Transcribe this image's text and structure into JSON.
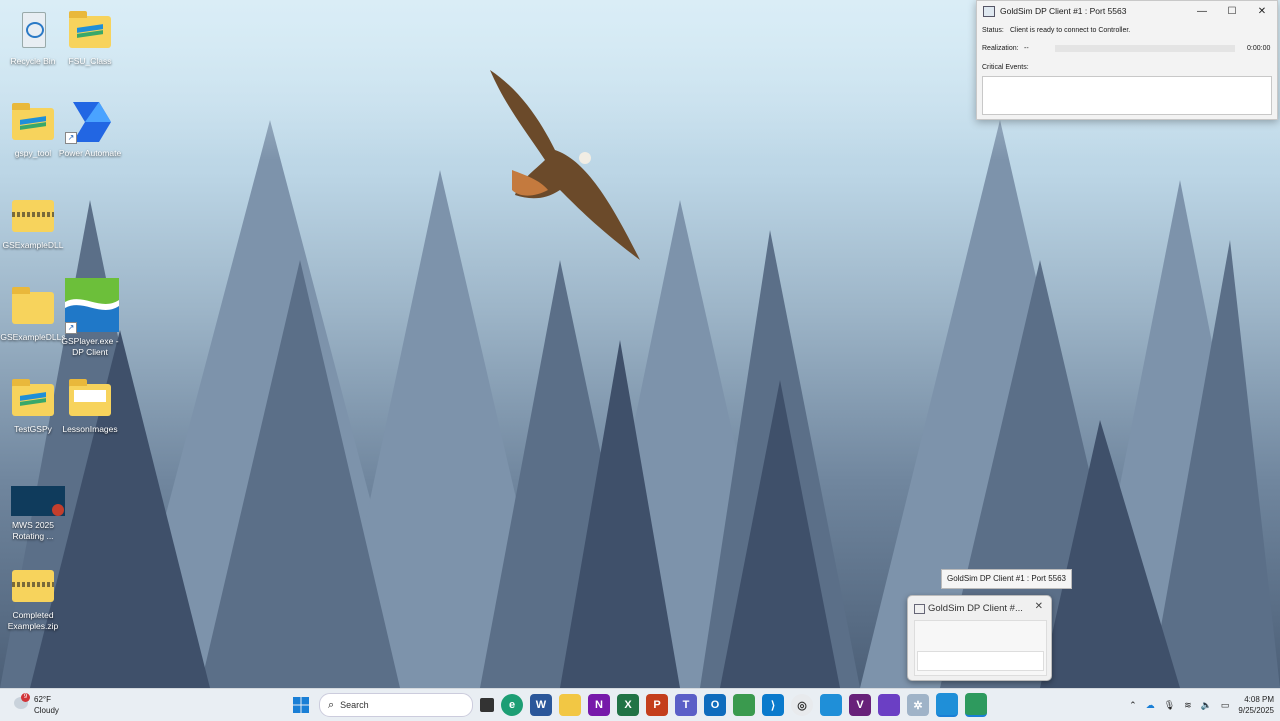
{
  "desktop_icons": [
    {
      "label": "Recycle Bin"
    },
    {
      "label": "FSU_Class"
    },
    {
      "label": "gspy_tool"
    },
    {
      "label": "Power Automate"
    },
    {
      "label": "GSExampleDLL"
    },
    {
      "label": "GSExampleDLLs"
    },
    {
      "label": "GSPlayer.exe - DP Client"
    },
    {
      "label": "TestGSPy"
    },
    {
      "label": "LessonImages"
    },
    {
      "label": "MWS 2025 Rotating ..."
    },
    {
      "label": "Completed Examples.zip"
    }
  ],
  "goldsim_window": {
    "title": "GoldSim DP Client #1 : Port 5563",
    "status_label": "Status:",
    "status_value": "Client is ready to connect to Controller.",
    "realization_label": "Realization:",
    "realization_value": "--",
    "elapsed": "0:00:00",
    "events_label": "Critical Events:",
    "minimize": "—",
    "maximize": "☐",
    "close": "✕"
  },
  "tooltip": "GoldSim DP Client #1 : Port 5563",
  "preview": {
    "title": "GoldSim DP Client #...",
    "close": "✕"
  },
  "taskbar": {
    "weather_temp": "62°F",
    "weather_desc": "Cloudy",
    "weather_badge": "9",
    "search_placeholder": "Search",
    "time": "4:08 PM",
    "date": "9/25/2025"
  },
  "colors": {
    "taskbar_bg": "#e9eef3",
    "folder_yellow": "#f7d35c",
    "accent_blue": "#1f8fd8"
  }
}
